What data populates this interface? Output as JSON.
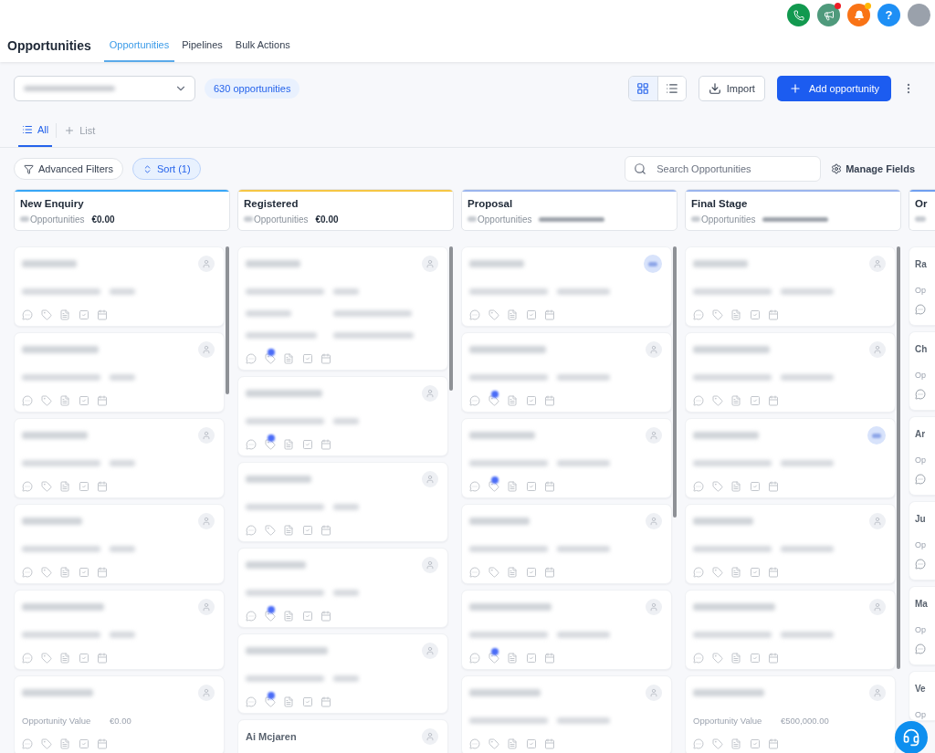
{
  "header_actions": [
    {
      "kind": "phone"
    },
    {
      "kind": "megaphone",
      "color": "#ee1c25"
    },
    {
      "kind": "bell",
      "color": "#ffb703"
    },
    {
      "kind": "help",
      "label": "?"
    },
    {
      "kind": "avatar"
    }
  ],
  "page_title": "Opportunities",
  "tabs": [
    {
      "label": "Opportunities",
      "selected": true
    },
    {
      "label": "Pipelines",
      "selected": false
    },
    {
      "label": "Bulk Actions",
      "selected": false
    }
  ],
  "count_badge": "630 opportunities",
  "view_toggle": [
    {
      "kind": "grid",
      "selected": true
    },
    {
      "kind": "list",
      "selected": false
    }
  ],
  "import_button": "Import",
  "add_button": "Add opportunity",
  "view_tabs": [
    {
      "label": "All",
      "selected": true
    }
  ],
  "add_view": "List",
  "filters": {
    "advanced": "Advanced Filters",
    "sort": "Sort (1)",
    "sort_active": true
  },
  "search": {
    "placeholder": "Search Opportunities"
  },
  "manage_fields": "Manage Fields",
  "columns": [
    {
      "kind": "full",
      "title": "New Enquiry",
      "color": "#38a6f6",
      "count_label": "Opportunities",
      "total": "€0.00",
      "cards": [
        {
          "kind": "basic",
          "assigned": false,
          "tag_dot": false
        },
        {
          "kind": "basic",
          "assigned": false,
          "tag_dot": false
        },
        {
          "kind": "basic",
          "assigned": false,
          "tag_dot": false
        },
        {
          "kind": "basic",
          "assigned": false,
          "tag_dot": false
        },
        {
          "kind": "basic",
          "assigned": false,
          "tag_dot": false
        },
        {
          "kind": "basic",
          "assigned": false,
          "tag_dot": false,
          "value_label": "Opportunity Value",
          "value": "€0.00"
        }
      ]
    },
    {
      "kind": "full",
      "title": "Registered",
      "color": "#f6c644",
      "count_label": "Opportunities",
      "total": "€0.00",
      "cards": [
        {
          "kind": "contact",
          "assigned": false,
          "tag_dot": true
        },
        {
          "kind": "basic",
          "assigned": false,
          "tag_dot": true
        },
        {
          "kind": "basic",
          "assigned": false,
          "tag_dot": false
        },
        {
          "kind": "basic",
          "assigned": false,
          "tag_dot": true
        },
        {
          "kind": "basic",
          "assigned": false,
          "tag_dot": true
        },
        {
          "kind": "name_only",
          "assigned": false,
          "name": "Ai Mcjaren"
        }
      ]
    },
    {
      "kind": "full",
      "title": "Proposal",
      "color": "#9bb5ee",
      "count_label": "Opportunities",
      "cards": [
        {
          "kind": "basic",
          "assigned": true,
          "tag_dot": false
        },
        {
          "kind": "basic",
          "assigned": false,
          "tag_dot": true
        },
        {
          "kind": "basic",
          "assigned": false,
          "tag_dot": true
        },
        {
          "kind": "basic",
          "assigned": false,
          "tag_dot": false
        },
        {
          "kind": "basic",
          "assigned": false,
          "tag_dot": true
        },
        {
          "kind": "basic",
          "assigned": false,
          "tag_dot": false
        }
      ]
    },
    {
      "kind": "full",
      "title": "Final Stage",
      "color": "#9bb5ee",
      "count_label": "Opportunities",
      "cards": [
        {
          "kind": "basic",
          "assigned": false,
          "tag_dot": false
        },
        {
          "kind": "basic",
          "assigned": false,
          "tag_dot": false
        },
        {
          "kind": "basic",
          "assigned": true,
          "tag_dot": false
        },
        {
          "kind": "basic",
          "assigned": false,
          "tag_dot": false
        },
        {
          "kind": "basic",
          "assigned": false,
          "tag_dot": false
        },
        {
          "kind": "basic",
          "assigned": false,
          "tag_dot": false,
          "value_label": "Opportunity Value",
          "value": "€500,000.00"
        }
      ]
    },
    {
      "kind": "edge",
      "title": "Or",
      "color": "#6f9ff0",
      "cards": [
        {
          "name": "Ra",
          "label": "Op",
          "footer": true
        },
        {
          "name": "Ch",
          "label": "Op",
          "footer": true
        },
        {
          "name": "Ar",
          "label": "Op",
          "footer": true
        },
        {
          "name": "Ju",
          "label": "Op",
          "footer": true
        },
        {
          "name": "Ma",
          "label": "Op",
          "footer": true
        },
        {
          "name": "Ve",
          "label": "Op",
          "footer": false
        }
      ]
    }
  ]
}
